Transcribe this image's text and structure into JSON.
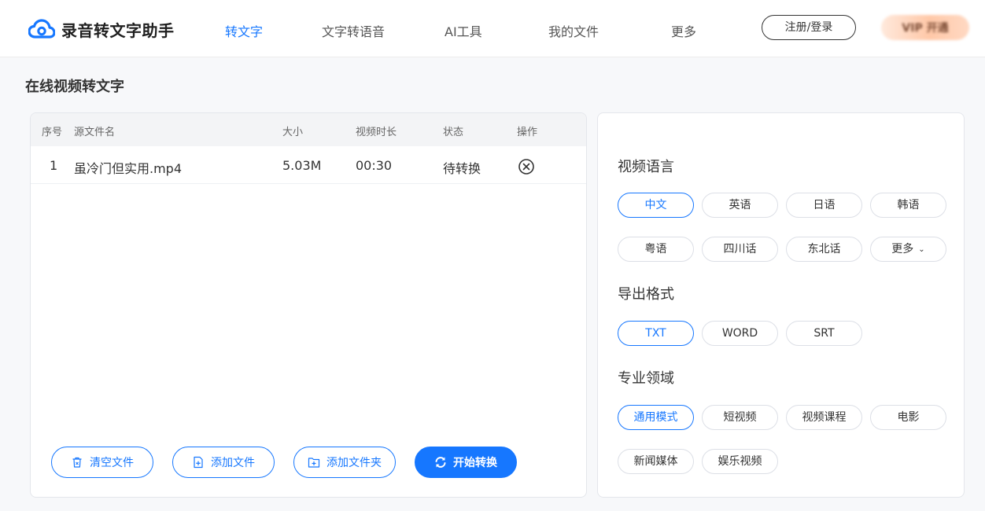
{
  "header": {
    "logo_text": "录音转文字助手",
    "nav": [
      {
        "label": "转文字",
        "active": true
      },
      {
        "label": "文字转语音",
        "active": false
      },
      {
        "label": "AI工具",
        "active": false
      },
      {
        "label": "我的文件",
        "active": false
      },
      {
        "label": "更多",
        "active": false
      }
    ],
    "login_label": "注册/登录",
    "vip_label": "VIP 开通"
  },
  "page": {
    "title": "在线视频转文字"
  },
  "table": {
    "columns": [
      "序号",
      "源文件名",
      "大小",
      "视频时长",
      "状态",
      "操作"
    ],
    "rows": [
      {
        "index": "1",
        "filename": "虽冷门但实用.mp4",
        "size": "5.03M",
        "duration": "00:30",
        "status": "待转换"
      }
    ]
  },
  "actions": {
    "clear": "清空文件",
    "add_file": "添加文件",
    "add_folder": "添加文件夹",
    "start": "开始转换"
  },
  "settings": {
    "language": {
      "title": "视频语言",
      "options": [
        "中文",
        "英语",
        "日语",
        "韩语",
        "粤语",
        "四川话",
        "东北话",
        "更多"
      ],
      "selected": "中文"
    },
    "format": {
      "title": "导出格式",
      "options": [
        "TXT",
        "WORD",
        "SRT"
      ],
      "selected": "TXT"
    },
    "domain": {
      "title": "专业领域",
      "options": [
        "通用模式",
        "短视频",
        "视频课程",
        "电影",
        "新闻媒体",
        "娱乐视频"
      ],
      "selected": "通用模式"
    }
  },
  "colors": {
    "accent": "#1677ff",
    "text": "#333333",
    "border": "#dcdfe6"
  }
}
